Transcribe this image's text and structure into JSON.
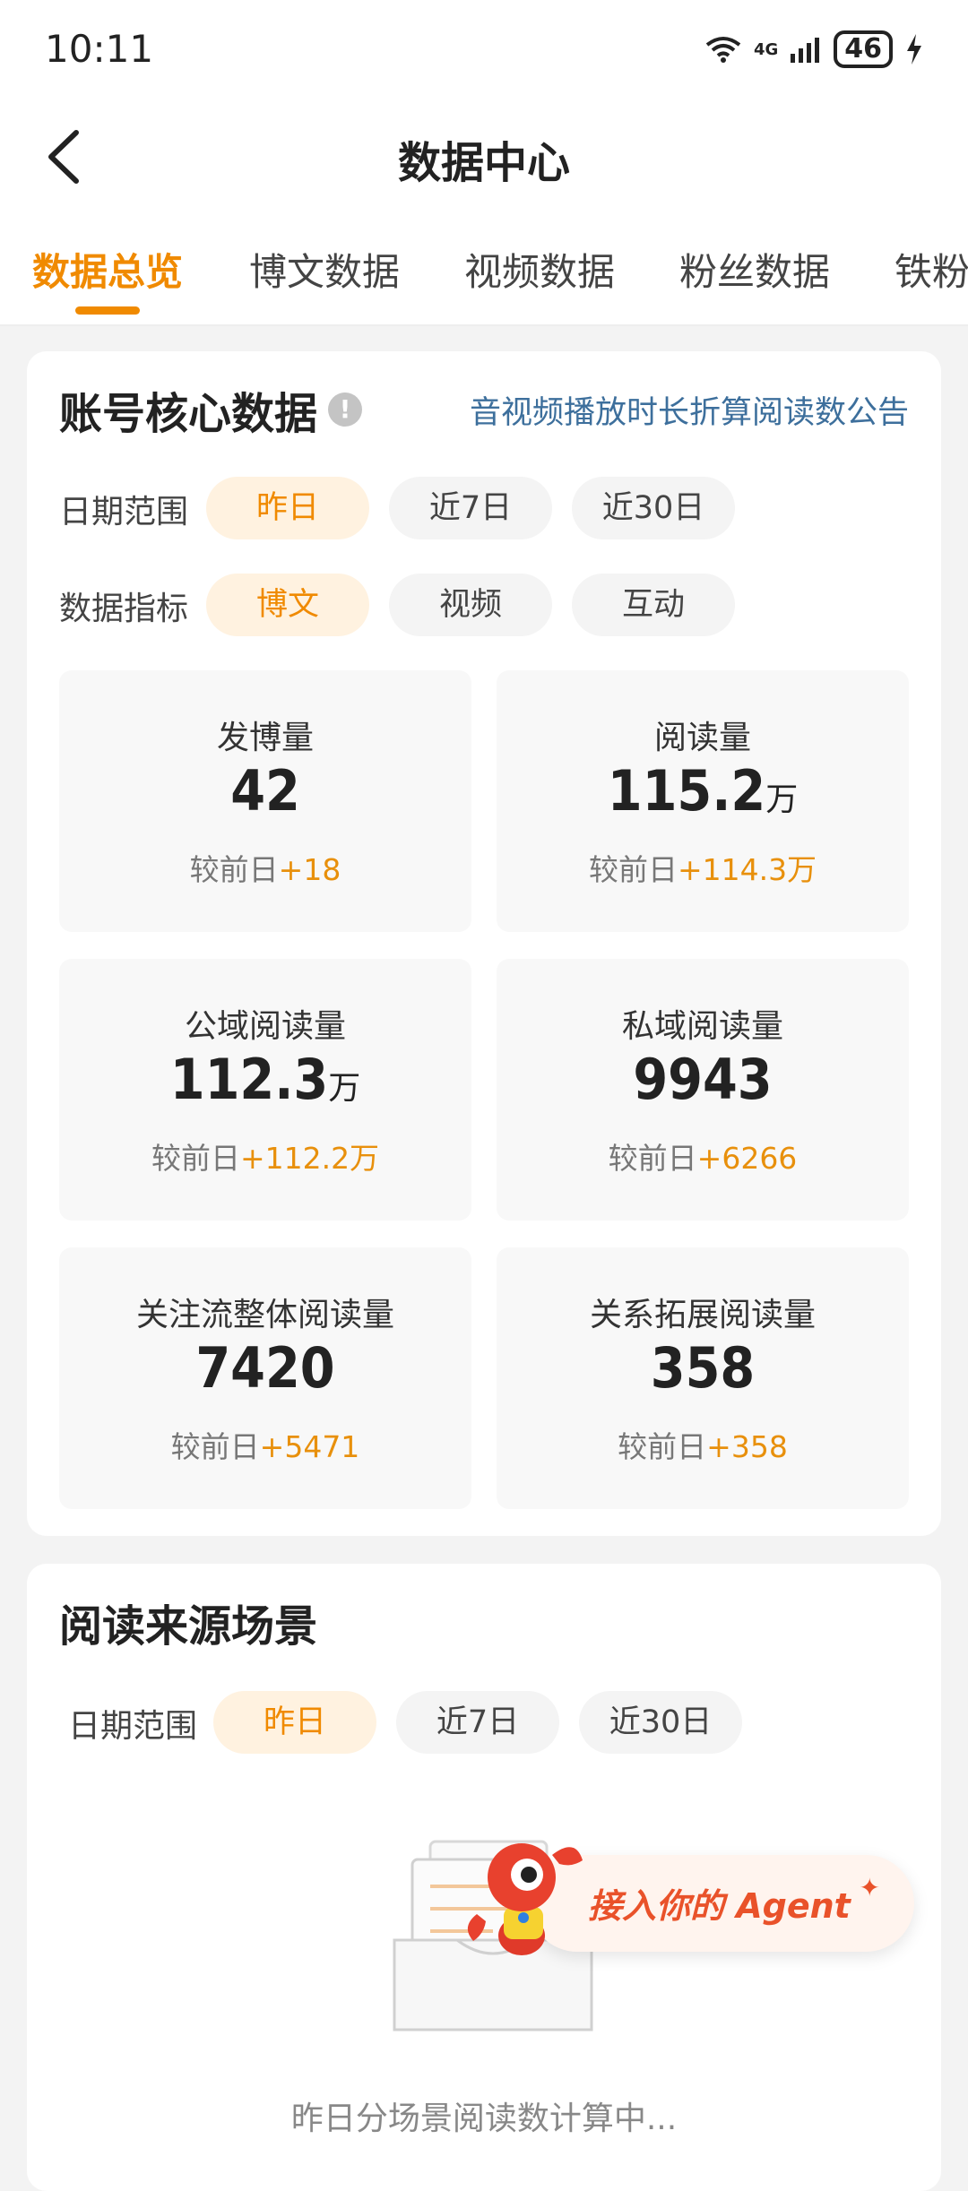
{
  "status_bar": {
    "time": "10:11",
    "network": "4G",
    "battery": "46"
  },
  "nav": {
    "title": "数据中心"
  },
  "tabs": [
    "数据总览",
    "博文数据",
    "视频数据",
    "粉丝数据",
    "铁粉"
  ],
  "core": {
    "title": "账号核心数据",
    "notice_link": "音视频播放时长折算阅读数公告",
    "date_label": "日期范围",
    "date_options": [
      "昨日",
      "近7日",
      "近30日"
    ],
    "metric_label": "数据指标",
    "metric_options": [
      "博文",
      "视频",
      "互动"
    ],
    "delta_prefix": "较前日",
    "metrics": [
      {
        "label": "发博量",
        "value": "42",
        "unit": "",
        "delta": "+18"
      },
      {
        "label": "阅读量",
        "value": "115.2",
        "unit": "万",
        "delta": "+114.3万"
      },
      {
        "label": "公域阅读量",
        "value": "112.3",
        "unit": "万",
        "delta": "+112.2万"
      },
      {
        "label": "私域阅读量",
        "value": "9943",
        "unit": "",
        "delta": "+6266"
      },
      {
        "label": "关注流整体阅读量",
        "value": "7420",
        "unit": "",
        "delta": "+5471"
      },
      {
        "label": "关系拓展阅读量",
        "value": "358",
        "unit": "",
        "delta": "+358"
      }
    ]
  },
  "source": {
    "title": "阅读来源场景",
    "date_label": "日期范围",
    "date_options": [
      "昨日",
      "近7日",
      "近30日"
    ],
    "empty_text": "昨日分场景阅读数计算中..."
  },
  "agent": {
    "text": "接入你的 Agent"
  },
  "colors": {
    "accent": "#f08a00",
    "delta": "#e8900c",
    "link": "#3d6f9c",
    "agent": "#e9522a"
  }
}
